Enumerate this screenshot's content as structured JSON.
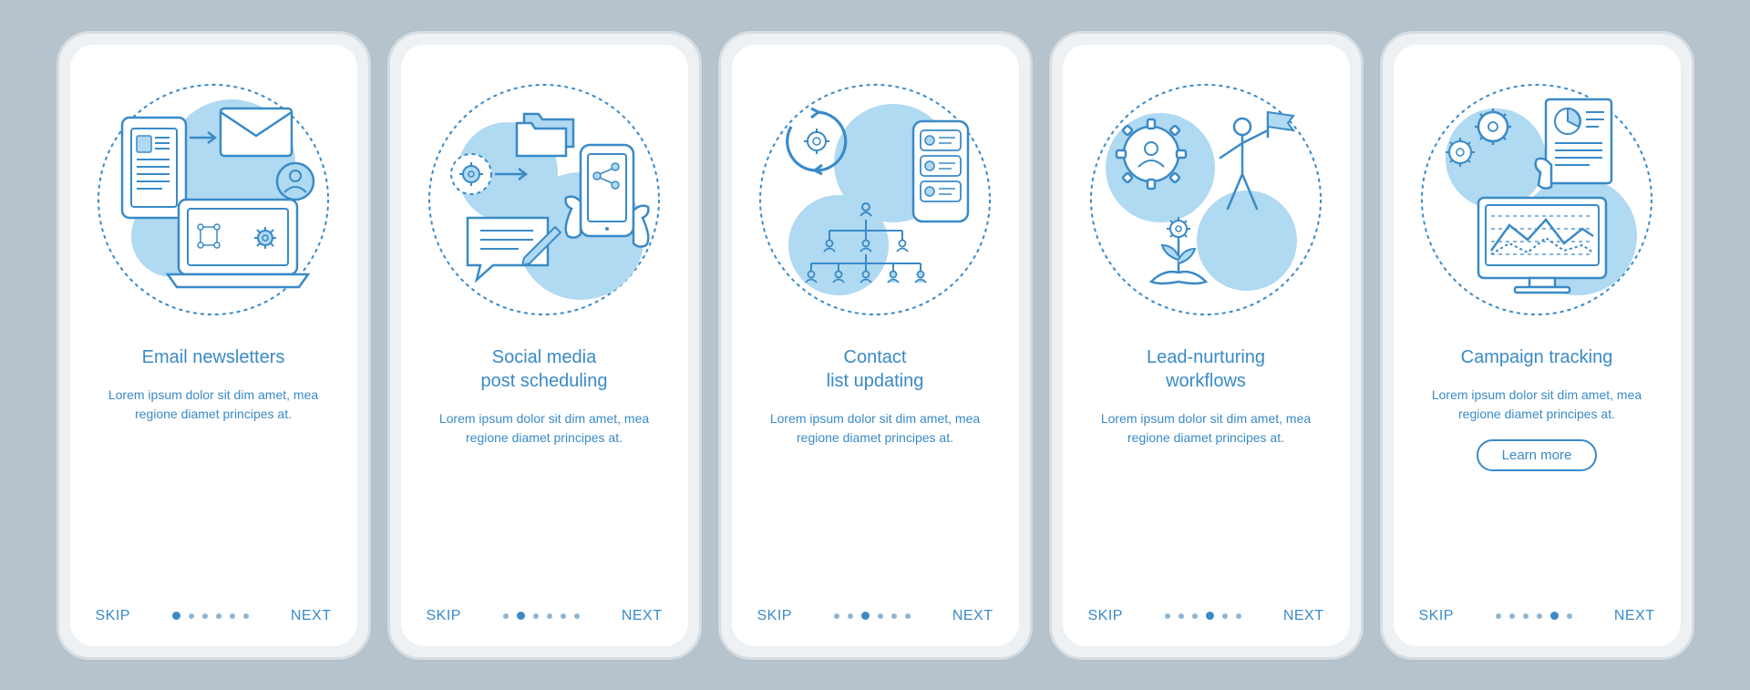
{
  "common": {
    "skip": "SKIP",
    "next": "NEXT",
    "body": "Lorem ipsum dolor sit dim amet, mea regione diamet principes at.",
    "learn_more": "Learn more"
  },
  "screens": [
    {
      "title": "Email newsletters",
      "active_dot": 0
    },
    {
      "title": "Social media\npost scheduling",
      "active_dot": 1
    },
    {
      "title": "Contact\nlist updating",
      "active_dot": 2
    },
    {
      "title": "Lead-nurturing\nworkflows",
      "active_dot": 3
    },
    {
      "title": "Campaign tracking",
      "active_dot": 4,
      "has_button": true
    }
  ],
  "total_dots": 6,
  "colors": {
    "brand": "#3a8ac7",
    "blob": "#b0d9f2",
    "bg": "#b6c3cc"
  }
}
